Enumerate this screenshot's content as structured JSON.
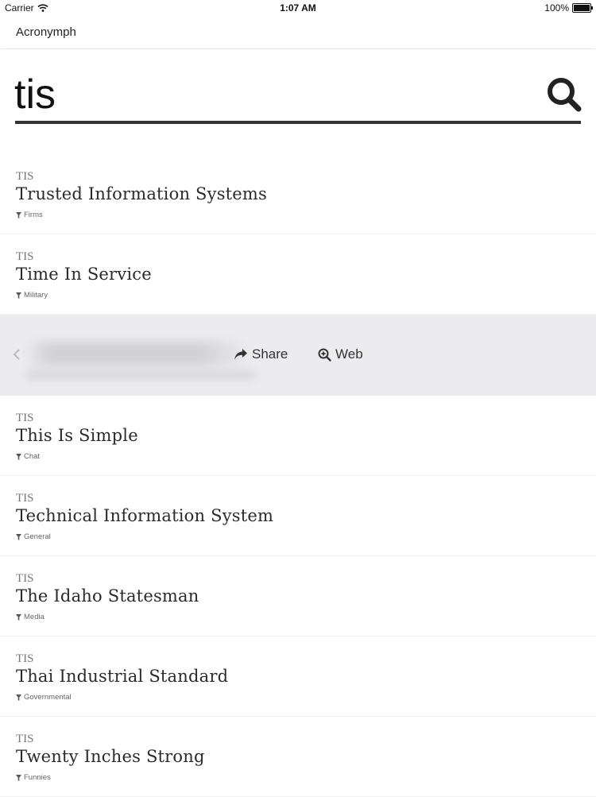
{
  "status_bar": {
    "carrier": "Carrier",
    "time": "1:07 AM",
    "battery": "100%",
    "battery_level": 1.0
  },
  "app": {
    "title": "Acronymph"
  },
  "search": {
    "query": "tis"
  },
  "results": [
    {
      "acronym": "TIS",
      "meaning": "Trusted Information Systems",
      "category": "Firms"
    },
    {
      "acronym": "TIS",
      "meaning": "Time In Service",
      "category": "Military"
    }
  ],
  "action_row": {
    "share_label": "Share",
    "web_label": "Web"
  },
  "results_after": [
    {
      "acronym": "TIS",
      "meaning": "This Is Simple",
      "category": "Chat"
    },
    {
      "acronym": "TIS",
      "meaning": "Technical Information System",
      "category": "General"
    },
    {
      "acronym": "TIS",
      "meaning": "The Idaho Statesman",
      "category": "Media"
    },
    {
      "acronym": "TIS",
      "meaning": "Thai Industrial Standard",
      "category": "Governmental"
    },
    {
      "acronym": "TIS",
      "meaning": "Twenty Inches Strong",
      "category": "Funnies"
    }
  ],
  "icons": {
    "wifi": "wifi-icon",
    "battery": "battery-icon",
    "search": "search-icon",
    "filter": "filter-icon",
    "share": "share-icon",
    "web": "zoom-in-icon",
    "back": "chevron-left-icon"
  }
}
